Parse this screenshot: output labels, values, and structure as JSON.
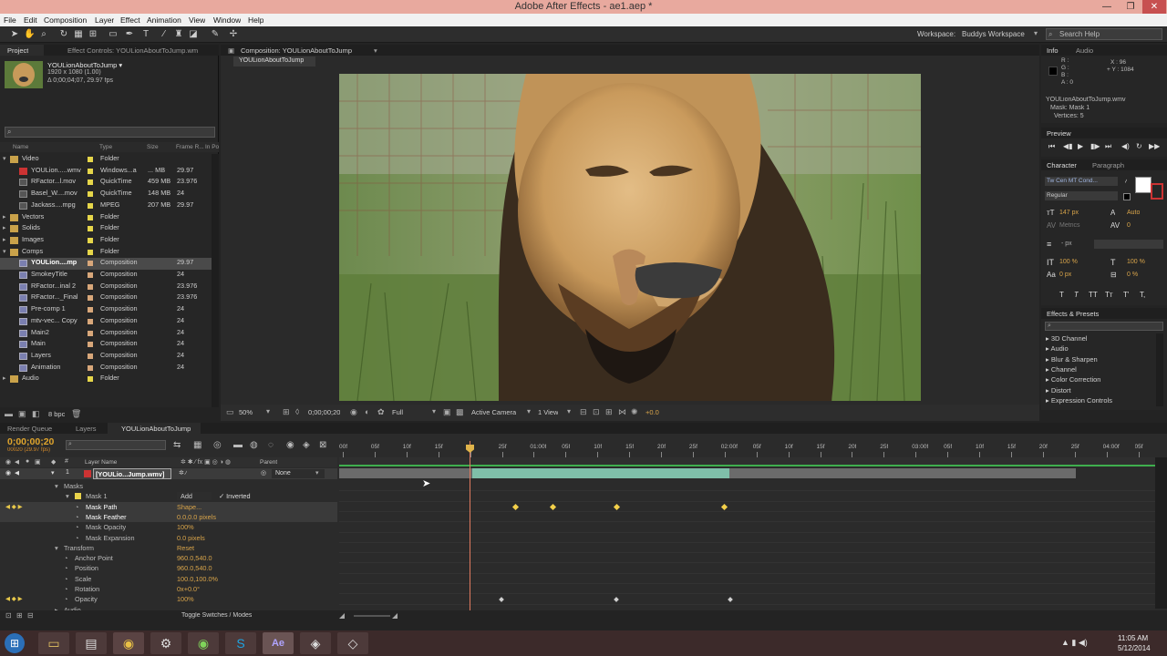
{
  "window": {
    "title": "Adobe After Effects - ae1.aep *"
  },
  "menu": [
    "File",
    "Edit",
    "Composition",
    "Layer",
    "Effect",
    "Animation",
    "View",
    "Window",
    "Help"
  ],
  "workspace": {
    "label": "Workspace:",
    "value": "Buddys Workspace",
    "search_placeholder": "Search Help"
  },
  "project_panel": {
    "tab": "Project",
    "effect_controls_tab": "Effect Controls: YOULionAboutToJump.wm",
    "thumb_name": "YOULionAboutToJump ▾",
    "thumb_info1": "1920 x 1080 (1.00)",
    "thumb_info2": "Δ 0;00;04;07, 29.97 fps",
    "columns": {
      "name": "Name",
      "type": "Type",
      "size": "Size",
      "rate": "Frame R...",
      "in": "In Po"
    },
    "rows": [
      {
        "name": "Video",
        "type": "Folder",
        "size": "",
        "rate": "",
        "color": "#e6d64a",
        "level": 0,
        "kind": "folder",
        "open": true
      },
      {
        "name": "YOULion.....wmv",
        "type": "Windows...a",
        "size": "... MB",
        "rate": "29.97",
        "color": "#e6d64a",
        "level": 1,
        "kind": "wmv"
      },
      {
        "name": "RFactor...l.mov",
        "type": "QuickTime",
        "size": "459 MB",
        "rate": "23.976",
        "color": "#e6d64a",
        "level": 1,
        "kind": "mov"
      },
      {
        "name": "Basel_W....mov",
        "type": "QuickTime",
        "size": "148 MB",
        "rate": "24",
        "color": "#e6d64a",
        "level": 1,
        "kind": "mov"
      },
      {
        "name": "Jackass....mpg",
        "type": "MPEG",
        "size": "207 MB",
        "rate": "29.97",
        "color": "#e6d64a",
        "level": 1,
        "kind": "mov"
      },
      {
        "name": "Vectors",
        "type": "Folder",
        "size": "",
        "rate": "",
        "color": "#e6d64a",
        "level": 0,
        "kind": "folder"
      },
      {
        "name": "Solids",
        "type": "Folder",
        "size": "",
        "rate": "",
        "color": "#e6d64a",
        "level": 0,
        "kind": "folder"
      },
      {
        "name": "Images",
        "type": "Folder",
        "size": "",
        "rate": "",
        "color": "#e6d64a",
        "level": 0,
        "kind": "folder"
      },
      {
        "name": "Comps",
        "type": "Folder",
        "size": "",
        "rate": "",
        "color": "#e6d64a",
        "level": 0,
        "kind": "folder",
        "open": true
      },
      {
        "name": "YOULion....mp",
        "type": "Composition",
        "size": "",
        "rate": "29.97",
        "color": "#d8a77a",
        "level": 1,
        "kind": "comp",
        "selected": true
      },
      {
        "name": "SmokeyTitle",
        "type": "Composition",
        "size": "",
        "rate": "24",
        "color": "#d8a77a",
        "level": 1,
        "kind": "comp"
      },
      {
        "name": "RFactor...inal 2",
        "type": "Composition",
        "size": "",
        "rate": "23.976",
        "color": "#d8a77a",
        "level": 1,
        "kind": "comp"
      },
      {
        "name": "RFactor..._Final",
        "type": "Composition",
        "size": "",
        "rate": "23.976",
        "color": "#d8a77a",
        "level": 1,
        "kind": "comp"
      },
      {
        "name": "Pre-comp 1",
        "type": "Composition",
        "size": "",
        "rate": "24",
        "color": "#d8a77a",
        "level": 1,
        "kind": "comp"
      },
      {
        "name": "mtv-vec... Copy",
        "type": "Composition",
        "size": "",
        "rate": "24",
        "color": "#d8a77a",
        "level": 1,
        "kind": "comp"
      },
      {
        "name": "Main2",
        "type": "Composition",
        "size": "",
        "rate": "24",
        "color": "#d8a77a",
        "level": 1,
        "kind": "comp"
      },
      {
        "name": "Main",
        "type": "Composition",
        "size": "",
        "rate": "24",
        "color": "#d8a77a",
        "level": 1,
        "kind": "comp"
      },
      {
        "name": "Layers",
        "type": "Composition",
        "size": "",
        "rate": "24",
        "color": "#d8a77a",
        "level": 1,
        "kind": "comp"
      },
      {
        "name": "Animation",
        "type": "Composition",
        "size": "",
        "rate": "24",
        "color": "#d8a77a",
        "level": 1,
        "kind": "comp"
      },
      {
        "name": "Audio",
        "type": "Folder",
        "size": "",
        "rate": "",
        "color": "#e6d64a",
        "level": 0,
        "kind": "folder"
      }
    ],
    "bpc": "8 bpc"
  },
  "composition": {
    "tab": "Composition: YOULionAboutToJump",
    "subtab": "YOULionAboutToJump",
    "zoom": "50%",
    "timecode": "0;00;00;20",
    "resolution": "Full",
    "camera": "Active Camera",
    "views": "1 View",
    "exposure": "+0.0"
  },
  "info_panel": {
    "tab": "Info",
    "audio_tab": "Audio",
    "r": "R :",
    "g": "G :",
    "b": "B :",
    "a": "A : 0",
    "x": "X : 96",
    "y": "+ Y : 1084",
    "layer": "YOULionAboutToJump.wmv",
    "mask": "Mask: Mask 1",
    "vertices": "Vertices: 5"
  },
  "preview_panel": {
    "tab": "Preview"
  },
  "character_panel": {
    "tab": "Character",
    "paragraph_tab": "Paragraph",
    "font": "Tw Cen MT Cond...",
    "style": "Regular",
    "size": "147 px",
    "leading": "Auto",
    "kerning": "Metrics",
    "tracking": "0",
    "stroke": "- px",
    "vscale": "100 %",
    "hscale": "100 %",
    "baseline": "0 px",
    "tsume": "0 %",
    "fmt": [
      "T",
      "T",
      "TT",
      "Tт",
      "T'",
      "T,"
    ]
  },
  "effects_panel": {
    "tab": "Effects & Presets",
    "items": [
      "3D Channel",
      "Audio",
      "Blur & Sharpen",
      "Channel",
      "Color Correction",
      "Distort",
      "Expression Controls"
    ]
  },
  "timeline": {
    "tabs": [
      "Render Queue",
      "Layers",
      "YOULionAboutToJump"
    ],
    "timecode": "0;00;00;20",
    "subtime": "00020 (29.97 fps)",
    "layer_header": "Layer Name",
    "parent_header": "Parent",
    "layer": {
      "num": "1",
      "name": "[YOULio...Jump.wmv]",
      "parent": "None"
    },
    "ruler": [
      "00f",
      "05f",
      "10f",
      "15f",
      "",
      "25f",
      "01:00f",
      "05f",
      "10f",
      "15f",
      "20f",
      "25f",
      "02:00f",
      "05f",
      "10f",
      "15f",
      "20f",
      "25f",
      "03:00f",
      "05f",
      "10f",
      "15f",
      "20f",
      "25f",
      "04:00f",
      "05f"
    ],
    "props": [
      {
        "name": "Masks",
        "value": "",
        "indent": 1,
        "kind": "group"
      },
      {
        "name": "Mask 1",
        "value": "Add",
        "indent": 2,
        "kind": "mask",
        "extra": "Inverted"
      },
      {
        "name": "Mask Path",
        "value": "Shape...",
        "indent": 3,
        "kind": "prop",
        "sel": true
      },
      {
        "name": "Mask Feather",
        "value": "0.0,0.0 pixels",
        "indent": 3,
        "kind": "prop",
        "sel": true
      },
      {
        "name": "Mask Opacity",
        "value": "100%",
        "indent": 3,
        "kind": "prop"
      },
      {
        "name": "Mask Expansion",
        "value": "0.0 pixels",
        "indent": 3,
        "kind": "prop"
      },
      {
        "name": "Transform",
        "value": "Reset",
        "indent": 1,
        "kind": "group"
      },
      {
        "name": "Anchor Point",
        "value": "960.0,540.0",
        "indent": 2,
        "kind": "prop"
      },
      {
        "name": "Position",
        "value": "960.0,540.0",
        "indent": 2,
        "kind": "prop"
      },
      {
        "name": "Scale",
        "value": "100.0,100.0%",
        "indent": 2,
        "kind": "prop"
      },
      {
        "name": "Rotation",
        "value": "0x+0.0°",
        "indent": 2,
        "kind": "prop"
      },
      {
        "name": "Opacity",
        "value": "100%",
        "indent": 2,
        "kind": "prop"
      },
      {
        "name": "Audio",
        "value": "",
        "indent": 1,
        "kind": "group"
      }
    ],
    "toggle_label": "Toggle Switches / Modes"
  },
  "taskbar": {
    "time": "11:05 AM",
    "date": "5/12/2014",
    "apps": [
      "explorer",
      "files",
      "chrome",
      "steam",
      "spotify",
      "skype",
      "after-effects",
      "app8",
      "app9"
    ]
  }
}
